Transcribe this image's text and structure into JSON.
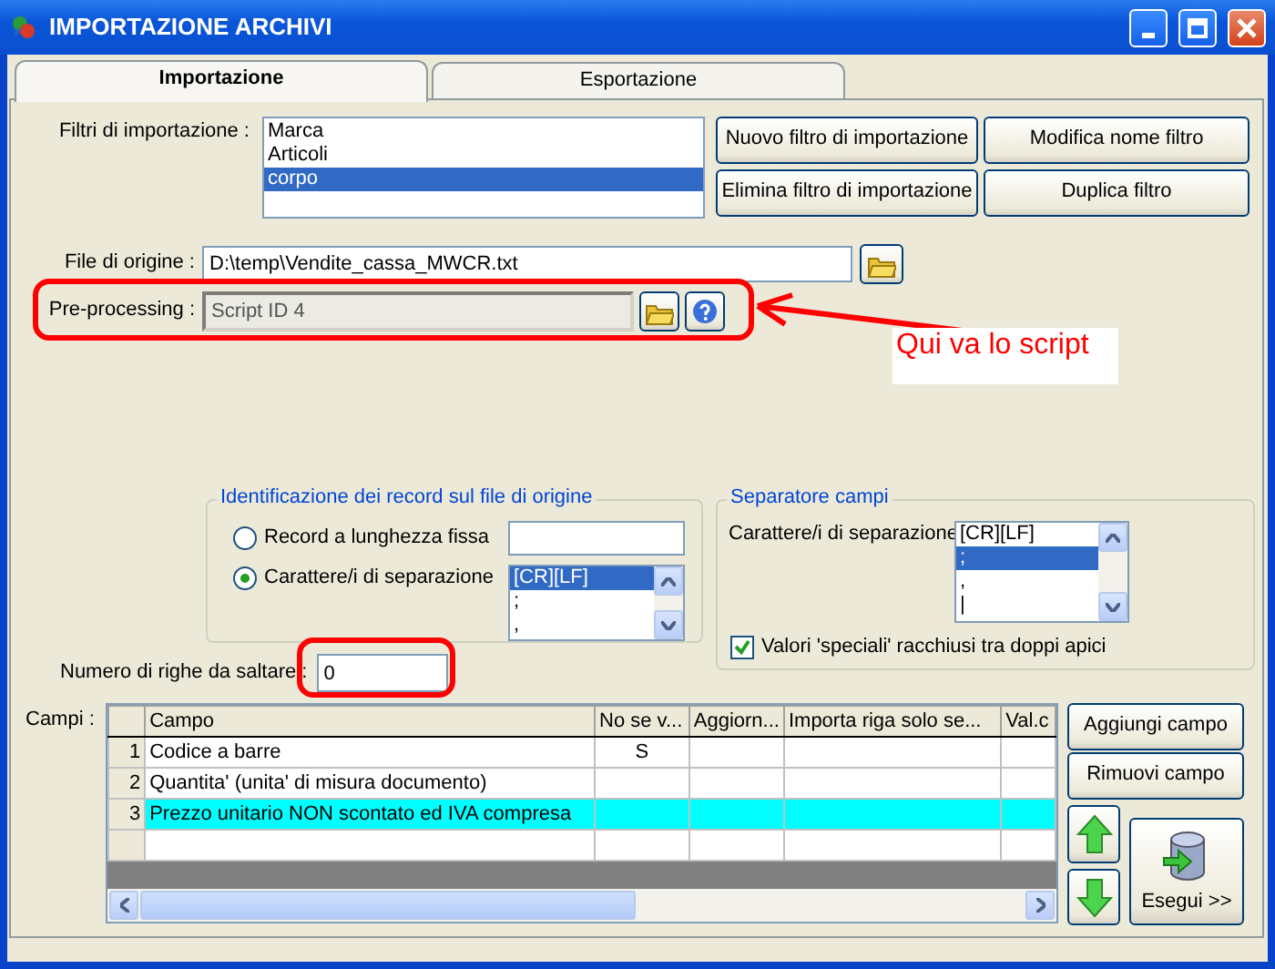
{
  "window": {
    "title": "IMPORTAZIONE ARCHIVI"
  },
  "tabs": [
    {
      "label": "Importazione",
      "selected": true
    },
    {
      "label": "Esportazione",
      "selected": false
    }
  ],
  "filters": {
    "label": "Filtri di importazione :",
    "items": [
      {
        "text": "Marca",
        "selected": false
      },
      {
        "text": "Articoli",
        "selected": false
      },
      {
        "text": "corpo",
        "selected": true
      }
    ]
  },
  "filter_buttons": [
    "Nuovo filtro di importazione",
    "Modifica nome filtro",
    "Elimina filtro di importazione",
    "Duplica filtro"
  ],
  "source_file": {
    "label": "File di origine :",
    "value": "D:\\temp\\Vendite_cassa_MWCR.txt"
  },
  "preprocessing": {
    "label": "Pre-processing :",
    "value": "Script ID 4",
    "disabled": true
  },
  "annotation": {
    "text": "Qui va lo script"
  },
  "record_identification": {
    "title": "Identificazione dei record sul file di origine",
    "options": [
      {
        "label": "Record a lunghezza fissa",
        "selected": false
      },
      {
        "label": "Carattere/i di separazione",
        "selected": true
      }
    ],
    "separators": [
      {
        "text": "[CR][LF]",
        "selected": true
      },
      {
        "text": ";",
        "selected": false
      },
      {
        "text": ",",
        "selected": false
      }
    ]
  },
  "field_separator": {
    "title": "Separatore campi",
    "label": "Carattere/i di separazione",
    "items": [
      {
        "text": "[CR][LF]",
        "selected": false
      },
      {
        "text": ";",
        "selected": true
      },
      {
        "text": ",",
        "selected": false
      },
      {
        "text": "|",
        "selected": false
      }
    ],
    "quoted_values": {
      "label": "Valori 'speciali' racchiusi tra doppi apici",
      "checked": true
    }
  },
  "skip_rows": {
    "label": "Numero di righe da saltare :",
    "value": "0"
  },
  "fields": {
    "label": "Campi :",
    "columns": [
      "Campo",
      "No se v...",
      "Aggiorn...",
      "Importa riga solo se...",
      "Val.c"
    ],
    "rows": [
      {
        "number": "1",
        "campo": "Codice a barre",
        "column_3": "S",
        "selected": false
      },
      {
        "number": "2",
        "campo": "Quantita' (unita' di misura documento)",
        "selected": false
      },
      {
        "number": "3",
        "campo": "Prezzo unitario NON scontato ed IVA compresa",
        "selected": true
      }
    ]
  },
  "field_buttons": [
    "Aggiungi campo",
    "Rimuovi campo"
  ],
  "run_button": "Esegui >>"
}
